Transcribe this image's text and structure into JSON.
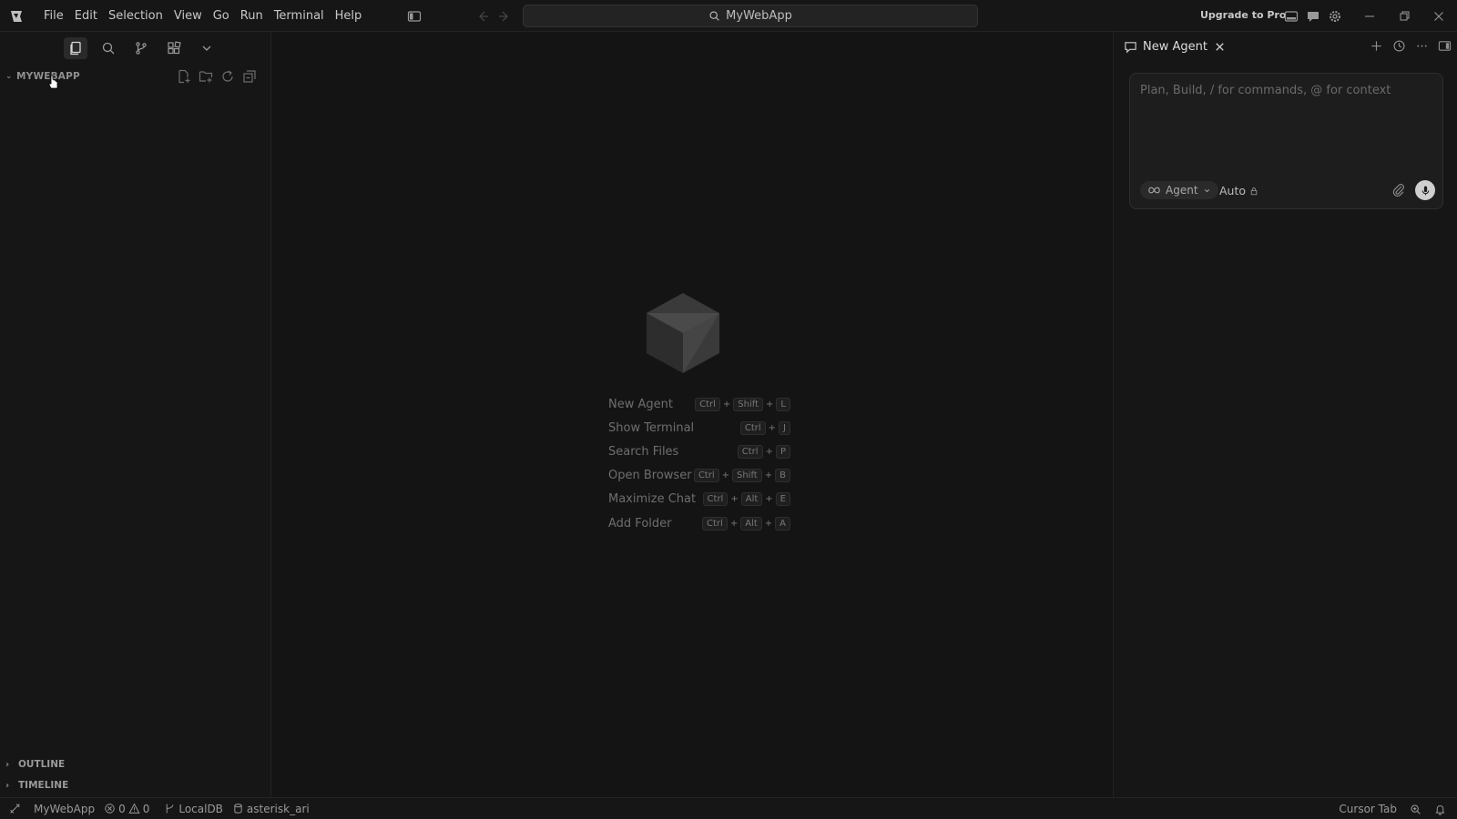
{
  "menu": [
    "File",
    "Edit",
    "Selection",
    "View",
    "Go",
    "Run",
    "Terminal",
    "Help"
  ],
  "search": {
    "text": "MyWebApp"
  },
  "titlebar": {
    "upgrade": "Upgrade to Pro"
  },
  "explorer": {
    "title": "MYWEBAPP"
  },
  "sections": {
    "outline": "OUTLINE",
    "timeline": "TIMELINE"
  },
  "shortcuts": [
    {
      "label": "New Agent",
      "keys": [
        "Ctrl",
        "Shift",
        "L"
      ]
    },
    {
      "label": "Show Terminal",
      "keys": [
        "Ctrl",
        "J"
      ]
    },
    {
      "label": "Search Files",
      "keys": [
        "Ctrl",
        "P"
      ]
    },
    {
      "label": "Open Browser",
      "keys": [
        "Ctrl",
        "Shift",
        "B"
      ]
    },
    {
      "label": "Maximize Chat",
      "keys": [
        "Ctrl",
        "Alt",
        "E"
      ]
    },
    {
      "label": "Add Folder",
      "keys": [
        "Ctrl",
        "Alt",
        "A"
      ]
    }
  ],
  "agent": {
    "tab_label": "New Agent",
    "placeholder": "Plan, Build, / for commands, @ for context",
    "mode": "Agent",
    "model": "Auto"
  },
  "status": {
    "project": "MyWebApp",
    "errors": "0",
    "warnings": "0",
    "branch": "LocalDB",
    "db": "asterisk_ari",
    "cursor_tab": "Cursor Tab"
  },
  "colors": {
    "background": "#141414",
    "panel": "#161616",
    "accent": "#cfcfcf"
  }
}
